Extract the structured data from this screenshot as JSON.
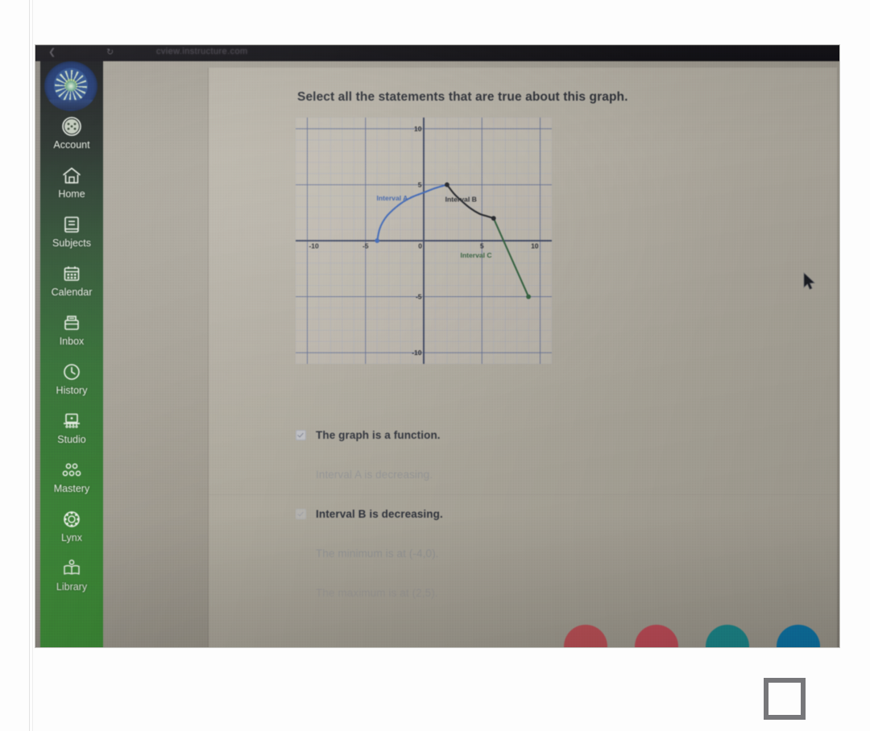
{
  "browser": {
    "url": "cview.instructure.com",
    "back_icon": "back-arrow-icon",
    "reload_icon": "reload-icon"
  },
  "sidebar": {
    "logo_name": "school-crest-logo",
    "items": [
      {
        "label": "Account",
        "icon": "account-avatar-icon"
      },
      {
        "label": "Home",
        "icon": "home-icon"
      },
      {
        "label": "Subjects",
        "icon": "book-icon"
      },
      {
        "label": "Calendar",
        "icon": "calendar-icon"
      },
      {
        "label": "Inbox",
        "icon": "inbox-envelope-icon"
      },
      {
        "label": "History",
        "icon": "clock-icon"
      },
      {
        "label": "Studio",
        "icon": "studio-screen-icon"
      },
      {
        "label": "Mastery",
        "icon": "mastery-nodes-icon"
      },
      {
        "label": "Lynx",
        "icon": "lynx-gear-icon"
      },
      {
        "label": "Library",
        "icon": "library-book-icon"
      }
    ]
  },
  "question": {
    "prompt": "Select all the statements that are true about this graph.",
    "choices": [
      {
        "text": "The graph is a function.",
        "checkbox": "checked",
        "state": "normal"
      },
      {
        "text": "Interval A is decreasing.",
        "checkbox": "none",
        "state": "faded"
      },
      {
        "text": "Interval B is decreasing.",
        "checkbox": "ghost",
        "state": "normal"
      },
      {
        "text": "The minimum is at (-4,0).",
        "checkbox": "none",
        "state": "faded"
      },
      {
        "text": "The maximum is at (2,5).",
        "checkbox": "none",
        "state": "faded2"
      }
    ]
  },
  "chart_data": {
    "type": "line",
    "title": "",
    "xlabel": "",
    "ylabel": "",
    "xlim": [
      -11,
      11
    ],
    "ylim": [
      -11,
      11
    ],
    "xticks": [
      -10,
      -5,
      0,
      5,
      10
    ],
    "yticks": [
      10,
      5,
      -5,
      -10
    ],
    "xtick_labels": [
      "-10",
      "-5",
      "0",
      "5",
      "10"
    ],
    "ytick_labels": [
      "10",
      "5",
      "-5",
      "-10"
    ],
    "grid": true,
    "grid_minor_step": 1,
    "grid_major_step": 5,
    "legend": "none",
    "annotations": [
      {
        "text": "Interval A",
        "x": -2.7,
        "y": 3.6,
        "color": "#3a5fa8"
      },
      {
        "text": "Interval B",
        "x": 3.2,
        "y": 3.5,
        "color": "#22242a"
      },
      {
        "text": "Interval C",
        "x": 4.5,
        "y": -1.5,
        "color": "#2f5c3a"
      }
    ],
    "series": [
      {
        "name": "Interval A",
        "color": "#3a63b4",
        "shape": "increasing-concave-down",
        "points": [
          [
            -4,
            0
          ],
          [
            -3.8,
            1.0
          ],
          [
            -3.5,
            1.7
          ],
          [
            -3.0,
            2.4
          ],
          [
            -2.0,
            3.3
          ],
          [
            -1.0,
            3.9
          ],
          [
            0,
            4.3
          ],
          [
            1.0,
            4.7
          ],
          [
            2,
            5
          ]
        ]
      },
      {
        "name": "Interval B",
        "color": "#1d1f24",
        "shape": "decreasing-convex",
        "points": [
          [
            2,
            5
          ],
          [
            2.6,
            4.2
          ],
          [
            3.2,
            3.6
          ],
          [
            4.0,
            2.9
          ],
          [
            4.8,
            2.4
          ],
          [
            5.4,
            2.2
          ],
          [
            6,
            2
          ]
        ]
      },
      {
        "name": "Interval C",
        "color": "#2d5c39",
        "shape": "decreasing-linear",
        "points": [
          [
            6,
            2
          ],
          [
            9,
            -5
          ]
        ]
      }
    ],
    "endpoints": [
      {
        "x": -4,
        "y": 0,
        "color": "#3a63b4",
        "label": "minimum"
      },
      {
        "x": 2,
        "y": 5,
        "color": "#1d1f24",
        "label": "maximum"
      },
      {
        "x": 6,
        "y": 2,
        "color": "#1d1f24",
        "label": "interval-b-end"
      },
      {
        "x": 9,
        "y": -5,
        "color": "#2d5c39",
        "label": "interval-c-end"
      }
    ]
  },
  "dashboard_cards": [
    {
      "color": "#c4545a"
    },
    {
      "color": "#c9505c"
    },
    {
      "color": "#1e8e92"
    },
    {
      "color": "#0f7bb0"
    },
    {
      "color": "#8f35a8"
    }
  ],
  "page_tools": {
    "expand_icon": "expand-crop-icon"
  },
  "cursor": {
    "icon": "mouse-pointer-icon"
  }
}
